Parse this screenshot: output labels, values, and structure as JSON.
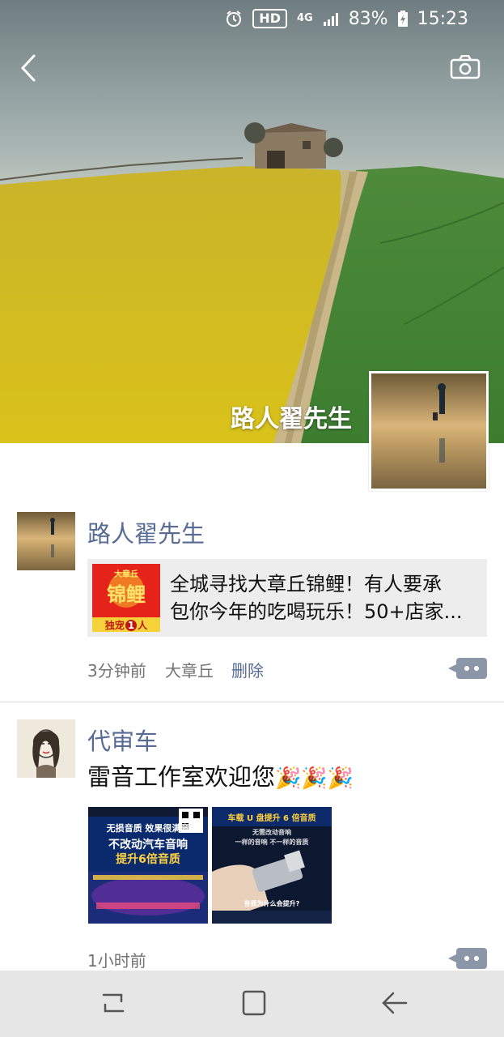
{
  "status_bar": {
    "hd": "HD",
    "network": "4G",
    "battery": "83%",
    "time": "15:23",
    "icons": [
      "alarm-icon",
      "signal-icon",
      "battery-icon"
    ]
  },
  "header": {
    "back_icon": "chevron-left-icon",
    "camera_icon": "camera-icon",
    "cover_name": "路人翟先生"
  },
  "posts": [
    {
      "user": "路人翟先生",
      "link": {
        "thumb_top": "大章丘",
        "thumb_main": "锦鲤",
        "thumb_bottom": "独宠",
        "thumb_badge": "1",
        "thumb_tail": "人",
        "title_line1": "全城寻找大章丘锦鲤！有人要承",
        "title_line2": "包你今年的吃喝玩乐！50+店家..."
      },
      "time": "3分钟前",
      "location": "大章丘",
      "delete": "删除"
    },
    {
      "user": "代审车",
      "text": "雷音工作室欢迎您",
      "emoji": [
        "🎉",
        "🎉",
        "🎉"
      ],
      "images": [
        {
          "line1": "无损音质 效果很满意",
          "line2": "不改动汽车音响",
          "line3": "提升6倍音质"
        },
        {
          "line1": "车载 U 盘提升 6 倍音质",
          "line2": "无需改动音响",
          "line3": "一样的音响 不一样的音质",
          "line4": "音质为什么会提升?"
        }
      ],
      "time": "1小时前"
    }
  ],
  "colors": {
    "username": "#576b95",
    "more_button": "#8c96a9",
    "meta_text": "#737373",
    "navbar": "#e6e6e6"
  }
}
